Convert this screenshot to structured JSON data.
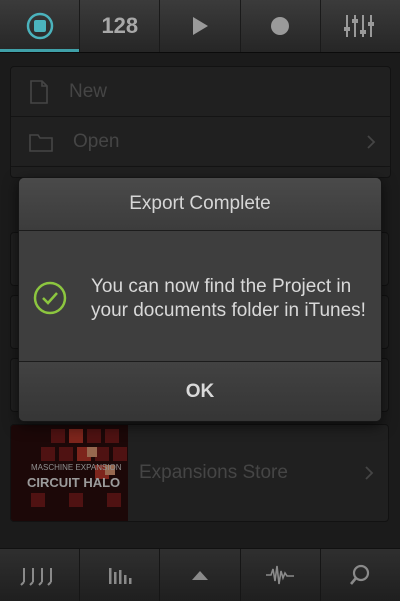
{
  "topbar": {
    "tempo": "128",
    "items": [
      {
        "name": "project-icon"
      },
      {
        "name": "tempo"
      },
      {
        "name": "play-icon"
      },
      {
        "name": "record-icon"
      },
      {
        "name": "mixer-icon"
      }
    ],
    "accent": "#3fa0a8"
  },
  "menu": {
    "items": [
      {
        "label": "New",
        "icon": "document-icon"
      },
      {
        "label": "Open",
        "icon": "folder-icon"
      }
    ],
    "store_label": "Expansions Store",
    "store_thumb": {
      "brand": "MASCHINE EXPANSION",
      "title": "CIRCUIT HALO"
    }
  },
  "dialog": {
    "title": "Export Complete",
    "message": "You can now find the Project in your documents folder in iTunes!",
    "ok_label": "OK",
    "check_color": "#8cc63f"
  },
  "bottombar": {
    "items": [
      "keyboard-icon",
      "levels-icon",
      "up-arrow-icon",
      "waveform-icon",
      "search-icon"
    ]
  }
}
